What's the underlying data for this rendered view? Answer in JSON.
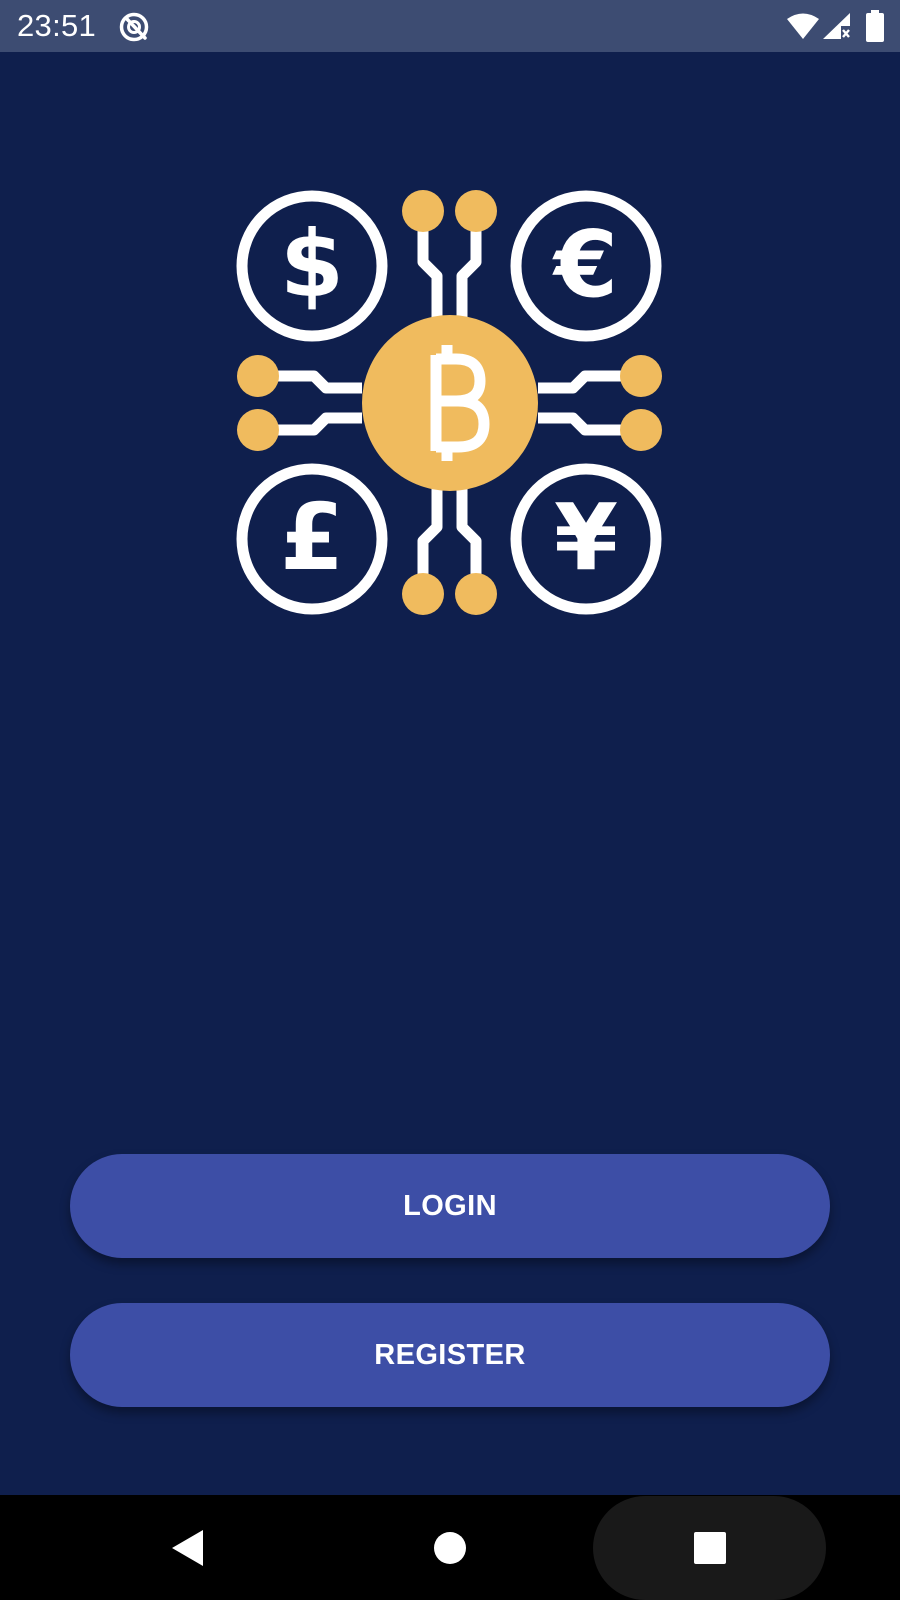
{
  "status_bar": {
    "time": "23:51",
    "icons": [
      "notification-app-icon",
      "wifi-icon",
      "signal-icon",
      "battery-icon"
    ],
    "background": "#3d4c72"
  },
  "logo": {
    "icon": "crypto-currency-logo-icon",
    "symbols": [
      "$",
      "€",
      "£",
      "¥",
      "฿"
    ],
    "accent_color": "#f0bb5e",
    "line_color": "#ffffff"
  },
  "buttons": {
    "login_label": "LOGIN",
    "register_label": "REGISTER",
    "color": "#3d4ea6"
  },
  "navigation_bar": {
    "icons": [
      "back-icon",
      "home-icon",
      "recents-icon"
    ]
  },
  "theme": {
    "background": "#0f1f4d"
  }
}
